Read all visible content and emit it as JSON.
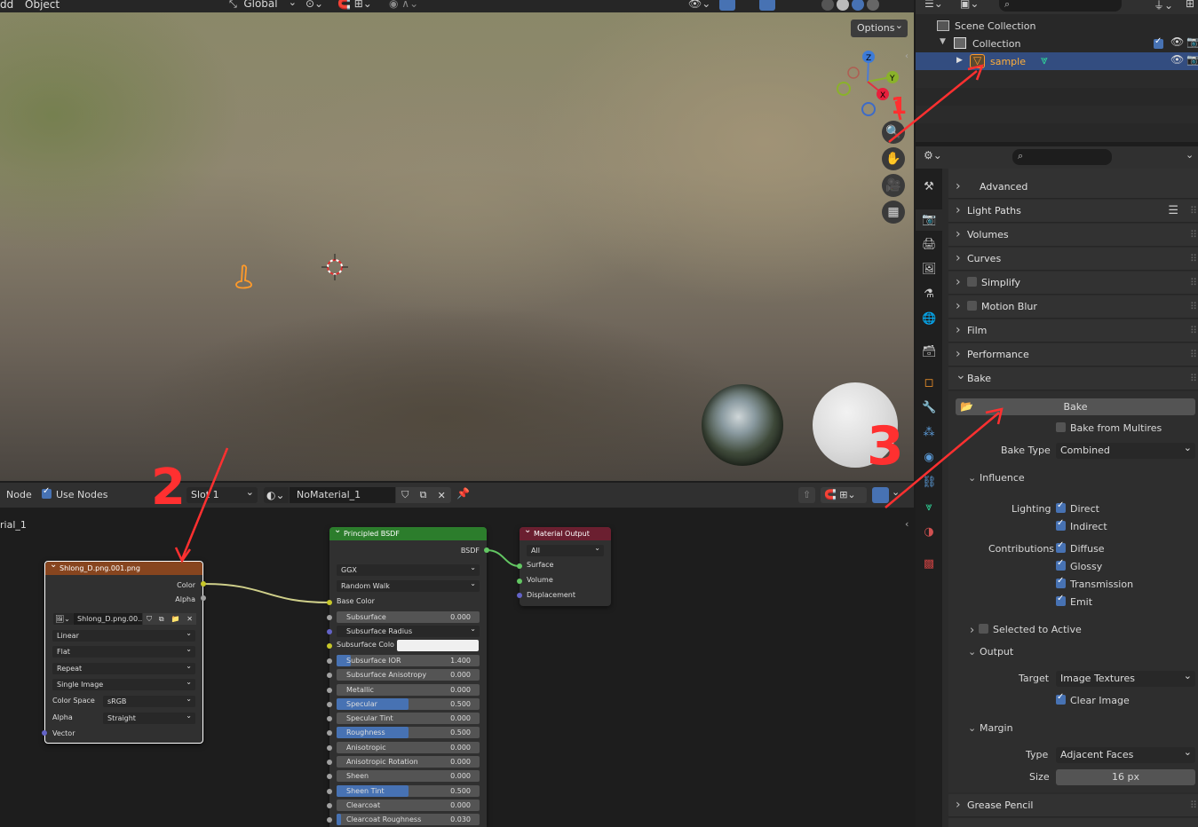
{
  "viewport_header": {
    "menu_add": "dd",
    "menu_object": "Object",
    "orientation": "Global",
    "options": "Options"
  },
  "outliner": {
    "scene_collection": "Scene Collection",
    "collection": "Collection",
    "object": "sample"
  },
  "properties": {
    "panels": {
      "advanced": "Advanced",
      "light_paths": "Light Paths",
      "volumes": "Volumes",
      "curves": "Curves",
      "simplify": "Simplify",
      "motion_blur": "Motion Blur",
      "film": "Film",
      "performance": "Performance",
      "bake": "Bake",
      "grease_pencil": "Grease Pencil"
    },
    "bake": {
      "button": "Bake",
      "from_multires": "Bake from Multires",
      "type_label": "Bake Type",
      "type_value": "Combined",
      "influence": "Influence",
      "lighting_label": "Lighting",
      "direct": "Direct",
      "indirect": "Indirect",
      "contributions_label": "Contributions",
      "diffuse": "Diffuse",
      "glossy": "Glossy",
      "transmission": "Transmission",
      "emit": "Emit",
      "selected_to_active": "Selected to Active",
      "output": "Output",
      "target_label": "Target",
      "target_value": "Image Textures",
      "clear_image": "Clear Image",
      "margin": "Margin",
      "margin_type_label": "Type",
      "margin_type_value": "Adjacent Faces",
      "size_label": "Size",
      "size_value": "16 px"
    }
  },
  "node_editor": {
    "menu_node": "Node",
    "use_nodes": "Use Nodes",
    "slot": "Slot 1",
    "material": "NoMaterial_1",
    "breadcrumb": "rial_1",
    "image_node": {
      "title": "Shlong_D.png.001.png",
      "out_color": "Color",
      "out_alpha": "Alpha",
      "image_name": "Shlong_D.png.00...",
      "interpolation": "Linear",
      "projection": "Flat",
      "extension": "Repeat",
      "source": "Single Image",
      "color_space_label": "Color Space",
      "color_space_value": "sRGB",
      "alpha_label": "Alpha",
      "alpha_value": "Straight",
      "in_vector": "Vector"
    },
    "bsdf_node": {
      "title": "Principled BSDF",
      "out_bsdf": "BSDF",
      "distribution": "GGX",
      "subsurface_method": "Random Walk",
      "base_color": "Base Color",
      "subsurface_color": "Subsurface Colo",
      "fields": [
        {
          "label": "Subsurface",
          "value": "0.000",
          "fill": 0
        },
        {
          "label": "Subsurface Radius",
          "value": "",
          "fill": 0
        },
        {
          "label": "Subsurface IOR",
          "value": "1.400",
          "fill": 0.1
        },
        {
          "label": "Subsurface Anisotropy",
          "value": "0.000",
          "fill": 0
        },
        {
          "label": "Metallic",
          "value": "0.000",
          "fill": 0
        },
        {
          "label": "Specular",
          "value": "0.500",
          "fill": 0.5
        },
        {
          "label": "Specular Tint",
          "value": "0.000",
          "fill": 0
        },
        {
          "label": "Roughness",
          "value": "0.500",
          "fill": 0.5
        },
        {
          "label": "Anisotropic",
          "value": "0.000",
          "fill": 0
        },
        {
          "label": "Anisotropic Rotation",
          "value": "0.000",
          "fill": 0
        },
        {
          "label": "Sheen",
          "value": "0.000",
          "fill": 0
        },
        {
          "label": "Sheen Tint",
          "value": "0.500",
          "fill": 0.5
        },
        {
          "label": "Clearcoat",
          "value": "0.000",
          "fill": 0
        },
        {
          "label": "Clearcoat Roughness",
          "value": "0.030",
          "fill": 0.03
        }
      ]
    },
    "output_node": {
      "title": "Material Output",
      "target": "All",
      "surface": "Surface",
      "volume": "Volume",
      "displacement": "Displacement"
    }
  },
  "annotations": {
    "one": "1",
    "two": "2",
    "three": "3"
  },
  "colors": {
    "accent": "#4772b3",
    "annotation_red": "#ff3030",
    "image_node_header": "#87451f",
    "bsdf_header": "#2c7d2c",
    "output_header": "#6b1f30"
  }
}
